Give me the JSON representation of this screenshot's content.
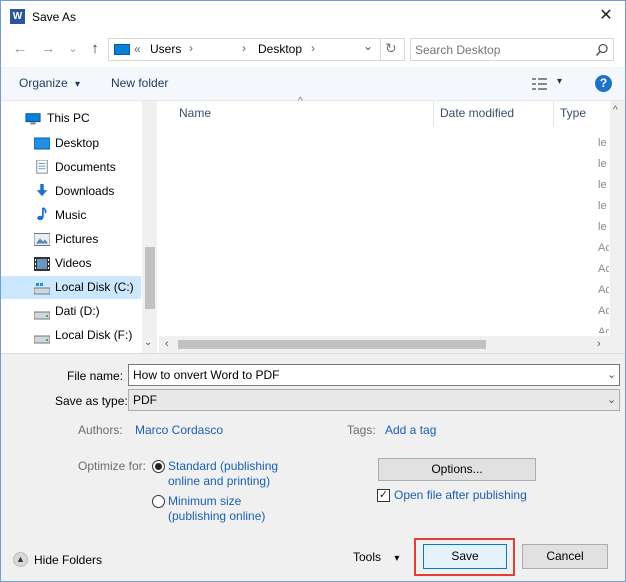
{
  "window": {
    "title": "Save As",
    "close_glyph": "✕",
    "app_icon_letter": "W"
  },
  "nav": {
    "back": "←",
    "forward": "→",
    "recent": "⌄",
    "up": "↑"
  },
  "address": {
    "sep1": "«",
    "seg1": "Users",
    "seg2": "Desktop",
    "chevron": "›",
    "dropdown": "⌄",
    "refresh": "↻"
  },
  "search": {
    "placeholder": "Search Desktop"
  },
  "toolbar": {
    "organize": "Organize",
    "new_folder": "New folder",
    "arrow": "▾",
    "help": "?"
  },
  "tree": {
    "items": [
      {
        "label": "This PC",
        "icon": "computer-icon"
      },
      {
        "label": "Desktop",
        "icon": "desktop-icon"
      },
      {
        "label": "Documents",
        "icon": "documents-icon"
      },
      {
        "label": "Downloads",
        "icon": "downloads-icon"
      },
      {
        "label": "Music",
        "icon": "music-icon"
      },
      {
        "label": "Pictures",
        "icon": "pictures-icon"
      },
      {
        "label": "Videos",
        "icon": "videos-icon"
      },
      {
        "label": "Local Disk (C:)",
        "icon": "drive-icon"
      },
      {
        "label": "Dati (D:)",
        "icon": "drive-icon"
      },
      {
        "label": "Local Disk (F:)",
        "icon": "drive-icon"
      }
    ]
  },
  "list": {
    "columns": [
      "Name",
      "Date modified",
      "Type"
    ],
    "type_fragments": [
      "le",
      "le",
      "le",
      "le",
      "le",
      "Ac",
      "Ac",
      "Ac",
      "Ac",
      "Ac"
    ]
  },
  "form": {
    "file_name_label": "File name:",
    "file_name_value": "How to onvert Word to PDF",
    "save_type_label": "Save as type:",
    "save_type_value": "PDF",
    "authors_label": "Authors:",
    "authors_value": "Marco Cordasco",
    "tags_label": "Tags:",
    "tags_value": "Add a tag",
    "optimize_label": "Optimize for:",
    "opt_standard_line1": "Standard (publishing",
    "opt_standard_line2": "online and printing)",
    "opt_min_line1": "Minimum size",
    "opt_min_line2": "(publishing online)",
    "options_button": "Options...",
    "open_after": "Open file after publishing",
    "check_glyph": "✓"
  },
  "footer": {
    "hide_folders": "Hide Folders",
    "tools": "Tools",
    "save": "Save",
    "cancel": "Cancel"
  },
  "colors": {
    "accent": "#0078d7",
    "highlight_box": "#e0403a"
  }
}
